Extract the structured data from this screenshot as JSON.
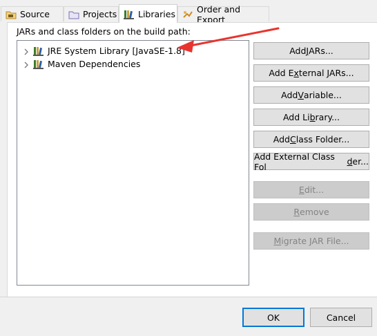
{
  "tabs": [
    {
      "label": "Source",
      "icon": "source-folder-icon"
    },
    {
      "label": "Projects",
      "icon": "project-folder-icon"
    },
    {
      "label": "Libraries",
      "icon": "libraries-icon",
      "active": true
    },
    {
      "label": "Order and Export",
      "icon": "order-export-icon"
    }
  ],
  "heading": "JARs and class folders on the build path:",
  "tree": [
    {
      "label": "JRE System Library [JavaSE-1.8]",
      "icon": "library-icon"
    },
    {
      "label": "Maven Dependencies",
      "icon": "library-icon"
    }
  ],
  "buttons": {
    "add_jars": {
      "pre": "Add ",
      "u": "J",
      "post": "ARs..."
    },
    "add_external_jars": {
      "pre": "Add E",
      "u": "x",
      "post": "ternal JARs..."
    },
    "add_variable": {
      "pre": "Add ",
      "u": "V",
      "post": "ariable..."
    },
    "add_library": {
      "pre": "Add Li",
      "u": "b",
      "post": "rary..."
    },
    "add_class_folder": {
      "pre": "Add ",
      "u": "C",
      "post": "lass Folder..."
    },
    "add_external_class_folder": {
      "pre": "Add External Class Fol",
      "u": "d",
      "post": "er..."
    },
    "edit": {
      "pre": "",
      "u": "E",
      "post": "dit..."
    },
    "remove": {
      "pre": "",
      "u": "R",
      "post": "emove"
    },
    "migrate_jar": {
      "pre": "",
      "u": "M",
      "post": "igrate JAR File..."
    }
  },
  "dialog": {
    "ok": "OK",
    "cancel": "Cancel"
  },
  "annotation": {
    "color": "#e8342e"
  }
}
